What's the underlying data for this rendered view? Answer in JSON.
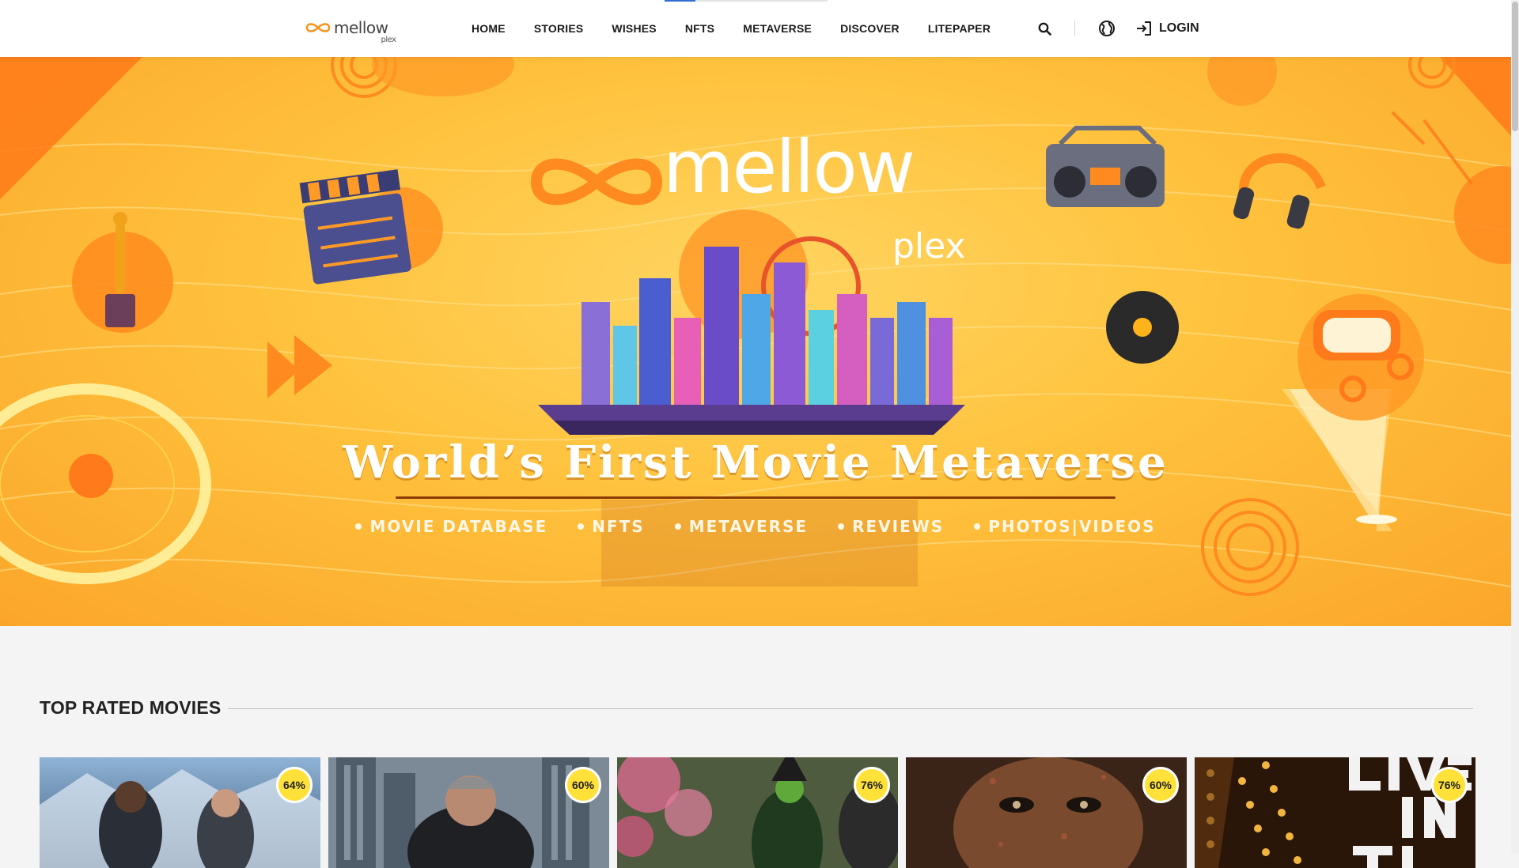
{
  "header": {
    "logo_text": "mellow",
    "logo_sub": "plex",
    "nav": [
      {
        "label": "HOME"
      },
      {
        "label": "STORIES"
      },
      {
        "label": "WISHES"
      },
      {
        "label": "NFTS"
      },
      {
        "label": "METAVERSE"
      },
      {
        "label": "DISCOVER"
      },
      {
        "label": "LITEPAPER"
      }
    ],
    "login_label": "LOGIN",
    "progress_fraction": 0.19
  },
  "hero": {
    "logo_text": "mellow",
    "logo_sub": "plex",
    "title": "World’s First Movie Metaverse",
    "features": [
      "MOVIE DATABASE",
      "NFTS",
      "METAVERSE",
      "REVIEWS",
      "PHOTOS|VIDEOS"
    ]
  },
  "section": {
    "title": "TOP RATED MOVIES"
  },
  "movies": [
    {
      "rating": "64%"
    },
    {
      "rating": "60%"
    },
    {
      "rating": "76%"
    },
    {
      "rating": "60%"
    },
    {
      "rating": "76%"
    }
  ],
  "colors": {
    "accent_yellow": "#ffe13a",
    "hero_orange": "#fba62a",
    "nav_progress": "#2e6fd1"
  },
  "icons": {
    "search": "search-icon",
    "language": "globe-icon",
    "login": "login-icon"
  }
}
